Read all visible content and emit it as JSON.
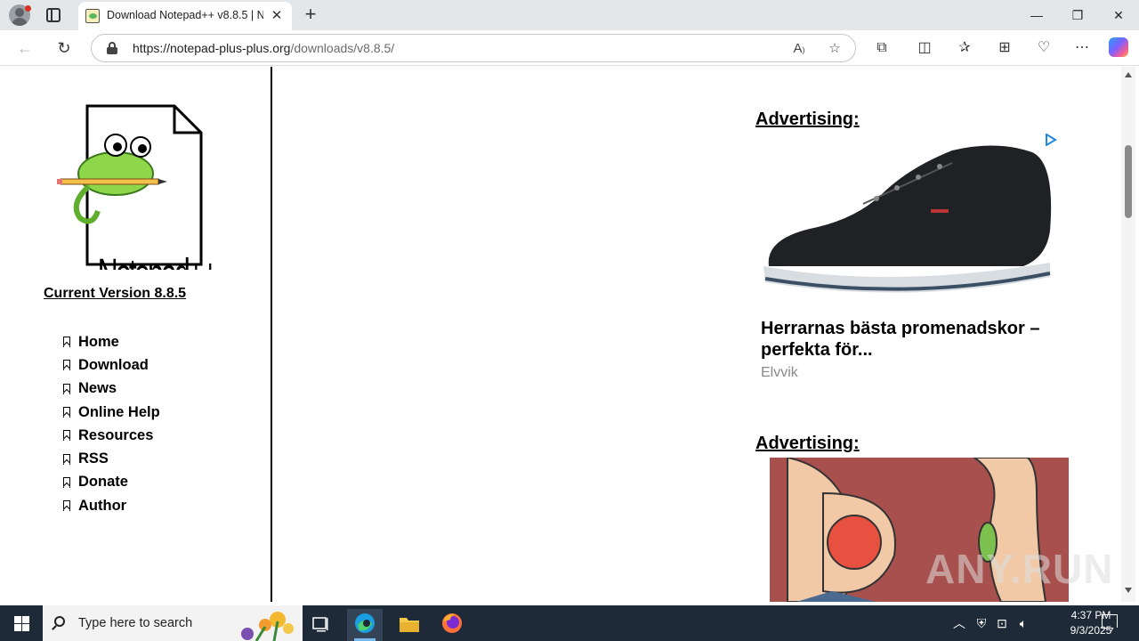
{
  "browser": {
    "tab": {
      "title": "Download Notepad++ v8.8.5 | Notepad++",
      "close_label": "✕"
    },
    "new_tab_label": "+",
    "window_controls": {
      "minimize": "—",
      "restore": "❐",
      "close": "✕"
    },
    "nav": {
      "back": "←",
      "refresh": "↻"
    },
    "address": {
      "host": "https://notepad-plus-plus.org",
      "path": "/downloads/v8.8.5/"
    },
    "icons": [
      "read-aloud-icon",
      "favorite-star-icon",
      "extensions-icon",
      "split-screen-icon",
      "favorites-icon",
      "collections-icon",
      "browser-essentials-icon",
      "more-menu-icon",
      "copilot-icon"
    ]
  },
  "sidebar": {
    "version_link": "Current Version 8.8.5",
    "menu": [
      {
        "label": "Home"
      },
      {
        "label": "Download"
      },
      {
        "label": "News"
      },
      {
        "label": "Online Help"
      },
      {
        "label": "Resources"
      },
      {
        "label": "RSS"
      },
      {
        "label": "Donate"
      },
      {
        "label": "Author"
      }
    ]
  },
  "ads": [
    {
      "heading": "Advertising:",
      "title": "Herrarnas bästa promenadskor – perfekta för...",
      "source": "Elvvik"
    },
    {
      "heading": "Advertising:"
    }
  ],
  "watermark": "ANY.RUN",
  "taskbar": {
    "search_placeholder": "Type here to search",
    "clock": {
      "time": "4:37 PM",
      "date": "9/3/2025"
    },
    "colors": {
      "background": "#1f2a38",
      "accent": "#76b9ed"
    }
  }
}
